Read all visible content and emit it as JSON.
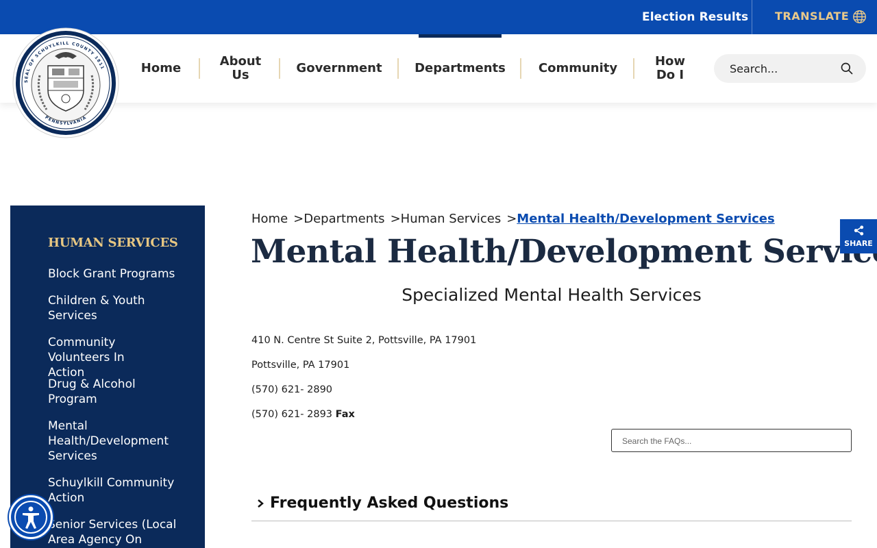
{
  "topbar": {
    "election_results": "Election Results",
    "translate": "TRANSLATE"
  },
  "seal": {
    "top_text": "SEAL OF SCHUYLKILL COUNTY 1811",
    "bottom_text": "PENNSYLVANIA"
  },
  "nav": {
    "items": [
      {
        "label": "Home"
      },
      {
        "label": "About\nUs"
      },
      {
        "label": "Government"
      },
      {
        "label": "Departments"
      },
      {
        "label": "Community"
      },
      {
        "label": "How\nDo I"
      }
    ],
    "search_placeholder": "Search..."
  },
  "sidebar": {
    "title": "HUMAN SERVICES",
    "links": [
      "Block Grant Programs",
      "Children & Youth Services",
      "Community Volunteers In Action",
      "Drug & Alcohol Program",
      "Mental Health/Development Services",
      "Schuylkill Community Action",
      "Senior Services (Local Area Agency On"
    ]
  },
  "breadcrumb": {
    "home": "Home",
    "departments": "Departments",
    "human_services": "Human Services",
    "current": "Mental Health/Development Services",
    "separator": ">"
  },
  "page": {
    "title": "Mental Health/Development Services",
    "subtitle": "Specialized Mental Health Services",
    "address1": "410 N. Centre St Suite 2, Pottsville, PA 17901",
    "address2": "Pottsville, PA 17901",
    "phone": "(570) 621- 2890",
    "fax_number": "(570) 621- 2893",
    "fax_label": "Fax"
  },
  "faq": {
    "search_placeholder": "Search the FAQs...",
    "heading": "Frequently Asked Questions"
  },
  "share": {
    "label": "SHARE"
  },
  "colors": {
    "brand_blue": "#0a4bb0",
    "navy": "#0b2a5a",
    "gold": "#e6c682"
  }
}
